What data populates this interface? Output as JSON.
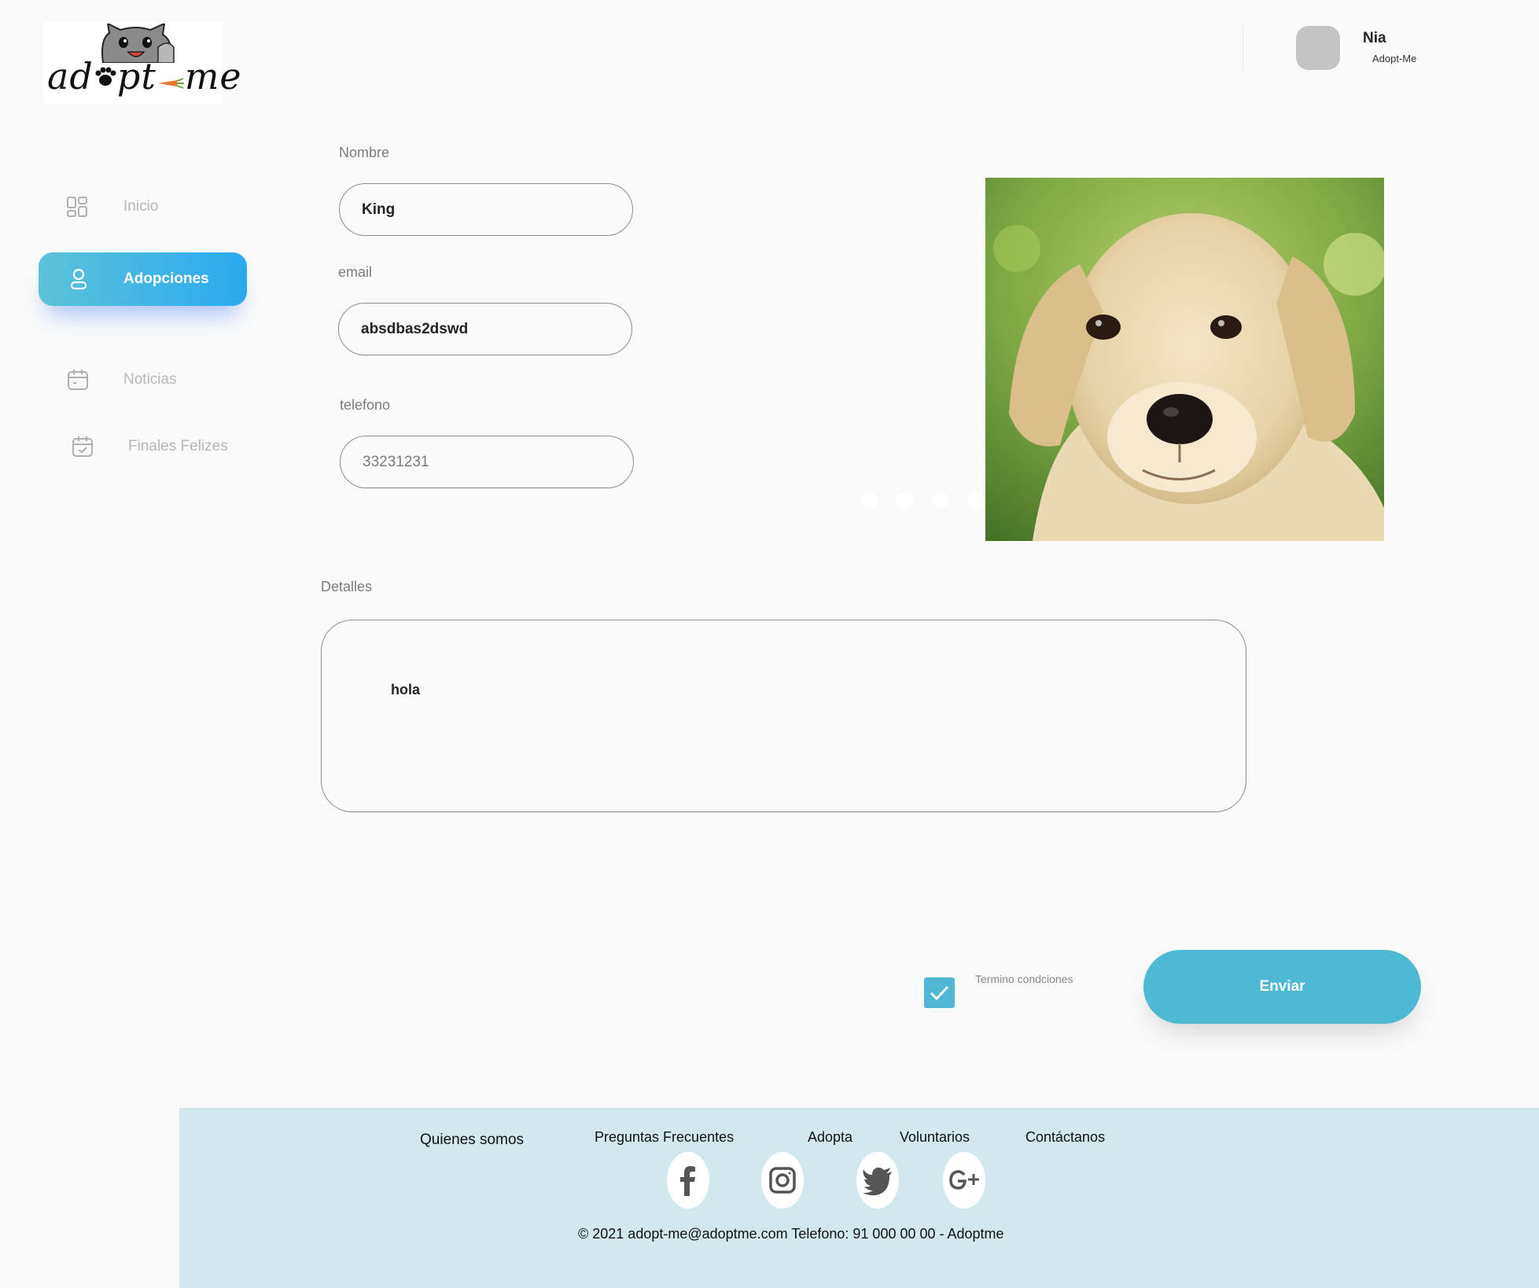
{
  "header": {
    "logo_text": "ad pt me",
    "user_name": "Nia",
    "user_org": "Adopt-Me"
  },
  "sidebar": {
    "items": [
      {
        "label": "Inicio",
        "icon": "dashboard-icon"
      },
      {
        "label": "Adopciones",
        "icon": "user-icon",
        "active": true
      },
      {
        "label": "Noticias",
        "icon": "calendar-icon"
      },
      {
        "label": "Finales Felizes",
        "icon": "calendar-check-icon"
      }
    ]
  },
  "form": {
    "nombre_label": "Nombre",
    "nombre_value": "King",
    "email_label": "email",
    "email_value": "absdbas2dswd",
    "telefono_label": "telefono",
    "telefono_value": "33231231",
    "detalles_label": "Detalles",
    "detalles_value": "hola",
    "terms_label": "Termino condciones",
    "terms_checked": true,
    "submit_label": "Enviar"
  },
  "photo": {
    "subject": "golden-labrador-puppy"
  },
  "footer": {
    "links": [
      "Quienes somos",
      "Preguntas Frecuentes",
      "Adopta",
      "Voluntarios",
      "Contáctanos"
    ],
    "social": [
      "facebook-icon",
      "instagram-icon",
      "twitter-icon",
      "google-plus-icon"
    ],
    "copyright": "© 2021 adopt-me@adoptme.com  Telefono:  91 000 00 00 - Adoptme"
  },
  "colors": {
    "accent": "#4db9d3",
    "active_gradient_start": "#5cc3d8",
    "active_gradient_end": "#2aa9f0",
    "footer_bg": "#d3e8ee"
  }
}
